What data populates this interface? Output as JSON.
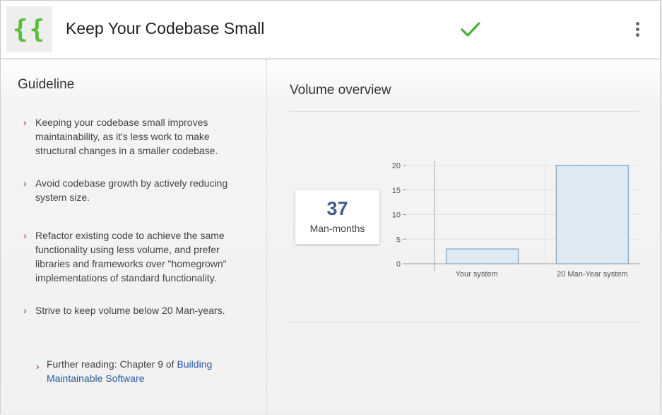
{
  "header": {
    "logo_text": "{{",
    "title": "Keep Your Codebase Small",
    "status_icon": "check-icon",
    "status_color": "#4caf3b",
    "menu_icon": "more-vertical-icon"
  },
  "guideline": {
    "title": "Guideline",
    "items": [
      "Keeping your codebase small improves maintainability, as it's less work to make structural changes in a smaller codebase.",
      "Avoid codebase growth by actively reducing system size.",
      "Refactor existing code to achieve the same functionality using less volume, and prefer libraries and frameworks over \"homegrown\" implementations of standard functionality.",
      "Strive to keep volume below 20 Man-years."
    ],
    "further_reading_prefix": "Further reading: Chapter 9 of ",
    "further_reading_link": "Building Maintainable Software"
  },
  "volume": {
    "title": "Volume overview",
    "metric_value": "37",
    "metric_unit": "Man-months"
  },
  "chart_data": {
    "type": "bar",
    "categories": [
      "Your system",
      "20 Man-Year system"
    ],
    "values": [
      3,
      20
    ],
    "ylim": [
      0,
      20
    ],
    "yticks": [
      "0",
      "5",
      "10",
      "15",
      "20"
    ],
    "grid": true,
    "bar_fill": "#dfe9f2",
    "bar_stroke": "#8db3cf"
  }
}
